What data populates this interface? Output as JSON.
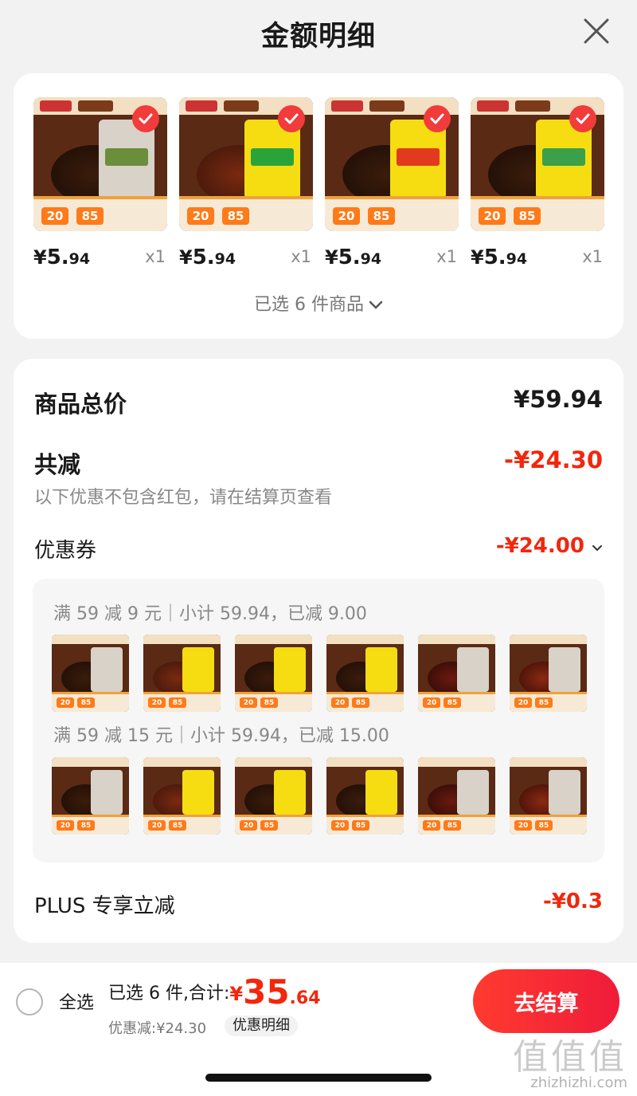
{
  "header": {
    "title": "金额明细"
  },
  "products": [
    {
      "price_yen": "¥",
      "price_int": "5.",
      "price_dec": "94",
      "qty": "x1",
      "promo_a": "20",
      "promo_b": "85",
      "pack": "light"
    },
    {
      "price_yen": "¥",
      "price_int": "5.",
      "price_dec": "94",
      "qty": "x1",
      "promo_a": "20",
      "promo_b": "85",
      "pack": "yellow"
    },
    {
      "price_yen": "¥",
      "price_int": "5.",
      "price_dec": "94",
      "qty": "x1",
      "promo_a": "20",
      "promo_b": "85",
      "pack": "yellow"
    },
    {
      "price_yen": "¥",
      "price_int": "5.",
      "price_dec": "94",
      "qty": "x1",
      "promo_a": "20",
      "promo_b": "85",
      "pack": "yellow"
    }
  ],
  "selected_summary": "已选 6 件商品",
  "detail": {
    "total_label": "商品总价",
    "total_value": "¥59.94",
    "reduce_label": "共减",
    "reduce_value": "-¥24.30",
    "note": "以下优惠不包含红包，请在结算页查看",
    "coupon_label": "优惠券",
    "coupon_value": "-¥24.00",
    "coupon_line_1": "满 59 减 9 元｜小计 59.94，已减 9.00",
    "coupon_line_2": "满 59 减 15 元｜小计 59.94，已减 15.00",
    "mini_promo_a": "20",
    "mini_promo_b": "85",
    "plus_label": "PLUS 专享立减",
    "plus_value": "-¥0.3"
  },
  "footer": {
    "select_all": "全选",
    "sum_prefix": "已选 6 件,合计:",
    "sum_yen": "¥",
    "sum_int": "35",
    "sum_dec": ".64",
    "discount": "优惠减:¥24.30",
    "detail_chip": "优惠明细",
    "checkout": "去结算"
  },
  "watermark": {
    "glyphs": "值值值",
    "url": "zhizhizhi.com"
  },
  "colors": {
    "accent_red": "#f2270c",
    "checkout_start": "#ff3b2f",
    "checkout_end": "#f01b3a",
    "promo_orange": "#ff7a18"
  }
}
